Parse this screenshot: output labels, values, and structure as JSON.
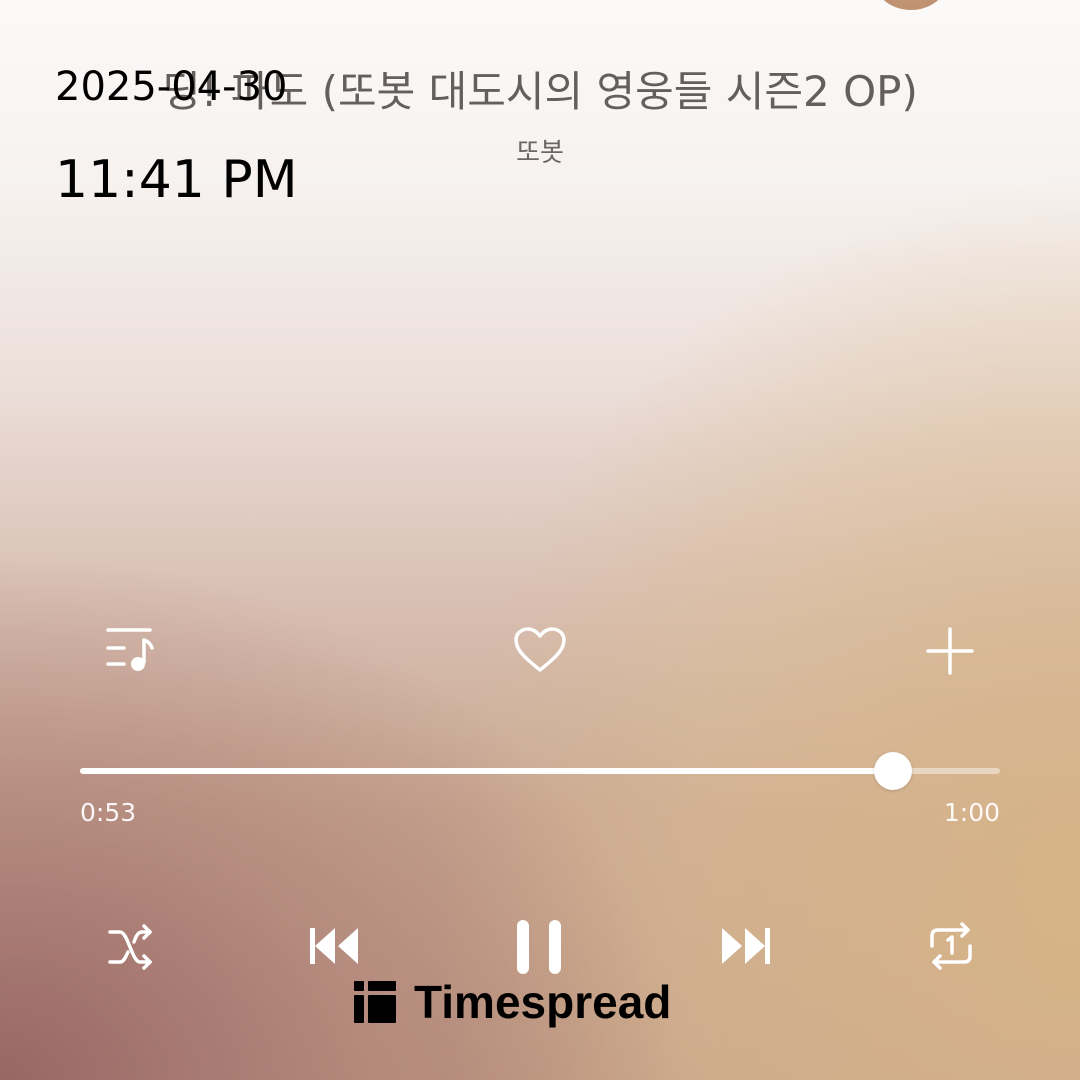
{
  "track": {
    "title": "딩! 파도 (또봇 대도시의 영웅들 시즌2 OP)",
    "artist": "또봇"
  },
  "timestamp": {
    "date": "2025-04-30",
    "time": "11:41 PM"
  },
  "actions": {
    "playlist_icon": "playlist-icon",
    "like_icon": "heart-icon",
    "add_icon": "plus-icon"
  },
  "progress": {
    "current": "0:53",
    "total": "1:00",
    "fraction": 0.8833
  },
  "controls": {
    "shuffle_icon": "shuffle-icon",
    "previous_icon": "skip-previous-icon",
    "play_state_icon": "pause-icon",
    "next_icon": "skip-next-icon",
    "repeat_icon": "repeat-one-icon"
  },
  "watermark": {
    "name": "Timespread"
  },
  "colors": {
    "icon": "#ffffff",
    "watermark": "#000000"
  }
}
